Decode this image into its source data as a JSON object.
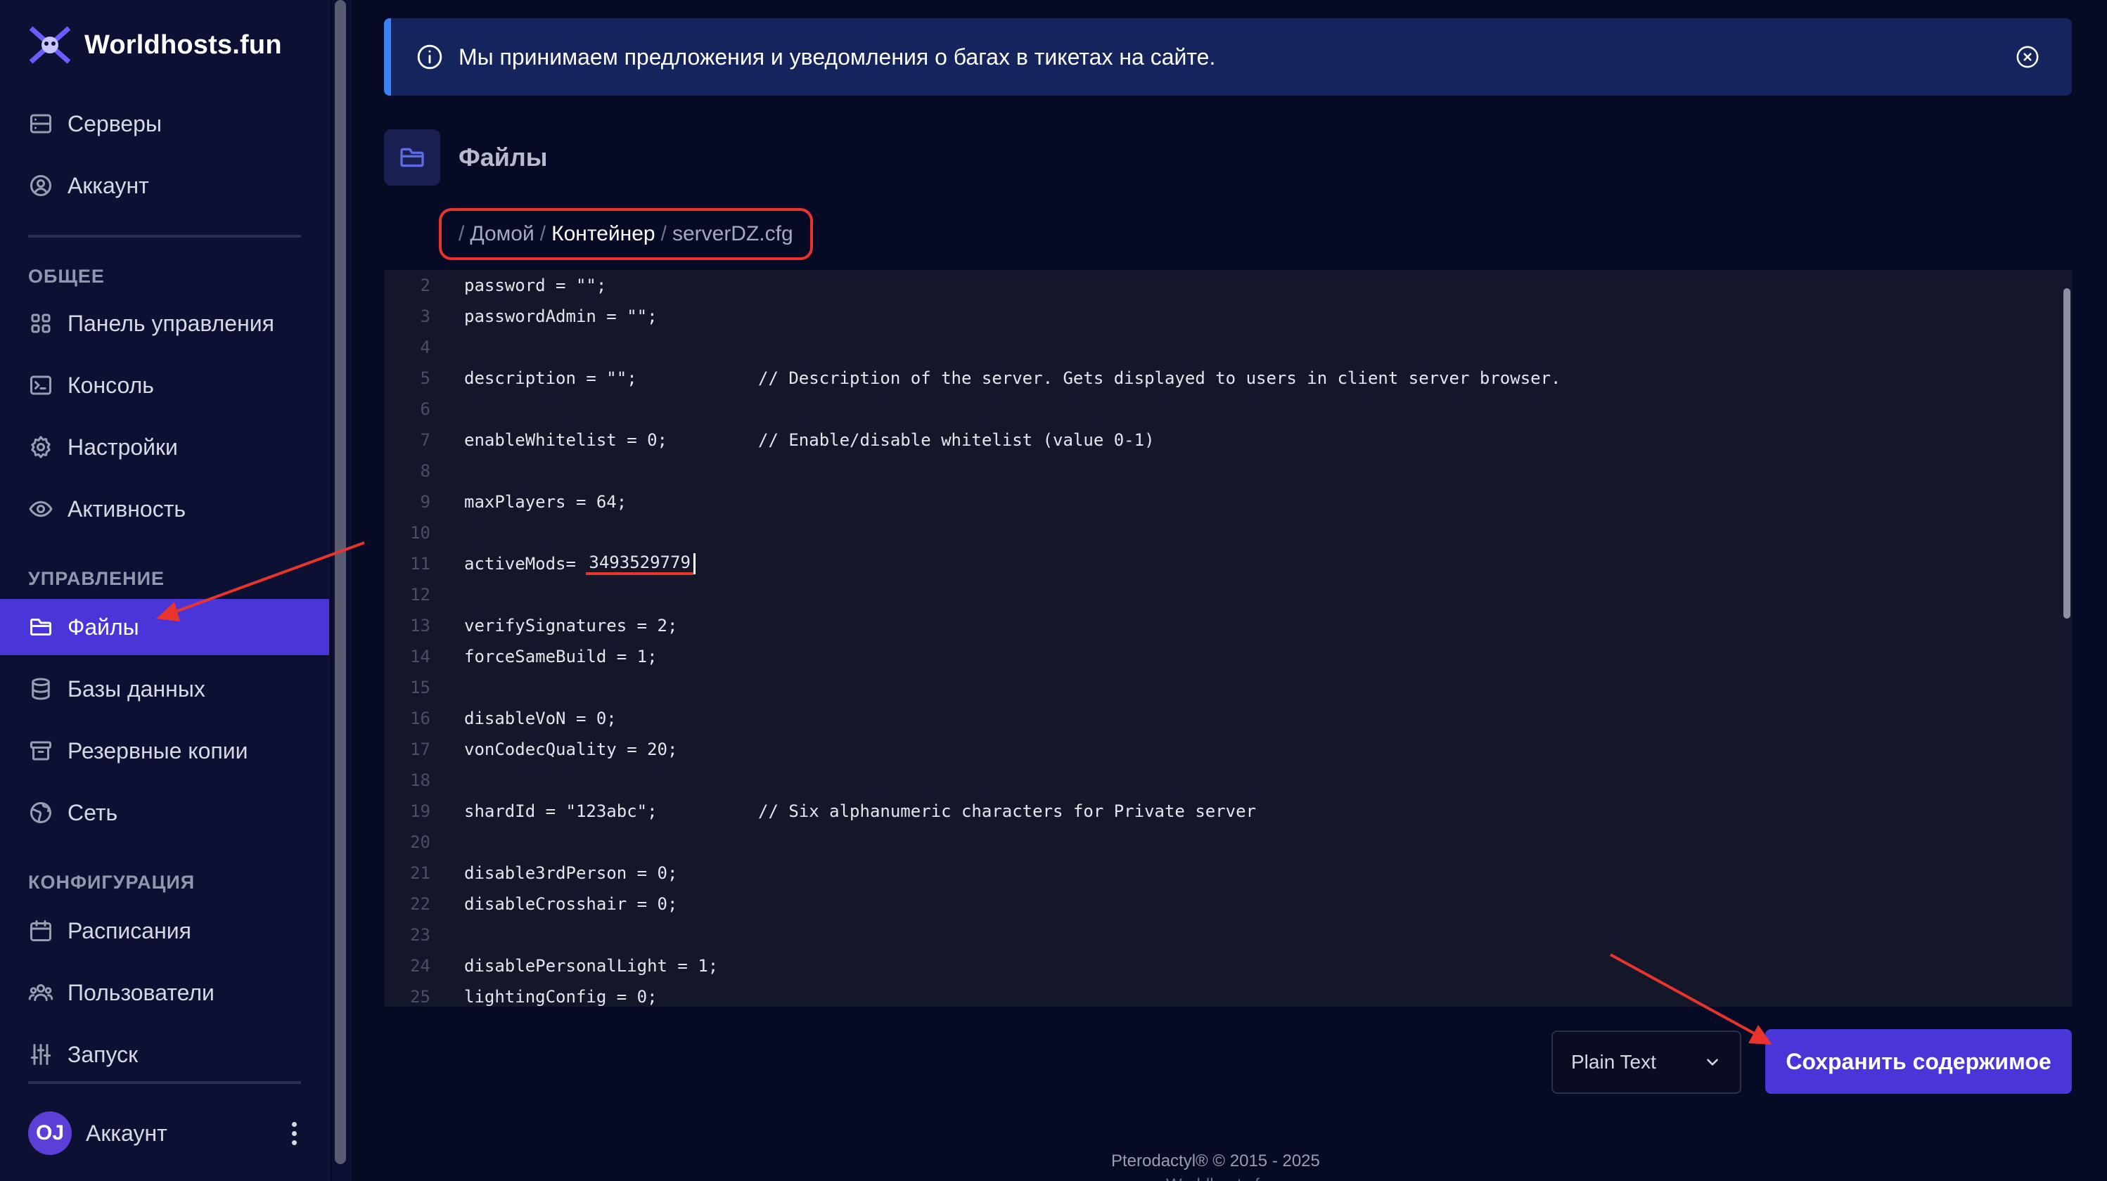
{
  "brand": {
    "name": "Worldhosts.fun"
  },
  "sidebar": {
    "top_items": [
      {
        "label": "Серверы",
        "icon": "server-icon"
      },
      {
        "label": "Аккаунт",
        "icon": "user-circle-icon"
      }
    ],
    "sections": {
      "general": "ОБЩЕЕ",
      "management": "УПРАВЛЕНИЕ",
      "configuration": "КОНФИГУРАЦИЯ"
    },
    "general_items": [
      {
        "label": "Панель управления",
        "icon": "grid-icon"
      },
      {
        "label": "Консоль",
        "icon": "terminal-icon"
      },
      {
        "label": "Настройки",
        "icon": "gear-icon"
      },
      {
        "label": "Активность",
        "icon": "eye-icon"
      }
    ],
    "management_items": [
      {
        "label": "Файлы",
        "icon": "folder-icon",
        "active": true
      },
      {
        "label": "Базы данных",
        "icon": "database-icon"
      },
      {
        "label": "Резервные копии",
        "icon": "archive-icon"
      },
      {
        "label": "Сеть",
        "icon": "globe-icon"
      }
    ],
    "configuration_items": [
      {
        "label": "Расписания",
        "icon": "calendar-icon"
      },
      {
        "label": "Пользователи",
        "icon": "users-icon"
      },
      {
        "label": "Запуск",
        "icon": "sliders-icon"
      }
    ],
    "account": {
      "initials": "OJ",
      "label": "Аккаунт"
    }
  },
  "alert": {
    "text": "Мы принимаем предложения и уведомления о багах в тикетах на сайте."
  },
  "page": {
    "title": "Файлы"
  },
  "breadcrumb": {
    "sep": "/",
    "home": "Домой",
    "folder": "Контейнер",
    "file": "serverDZ.cfg"
  },
  "editor": {
    "lines": [
      {
        "n": "2",
        "code": "password = \"\";"
      },
      {
        "n": "3",
        "code": "passwordAdmin = \"\";"
      },
      {
        "n": "4",
        "code": ""
      },
      {
        "n": "5",
        "code": "description = \"\";",
        "comment": "// Description of the server. Gets displayed to users in client server browser."
      },
      {
        "n": "6",
        "code": ""
      },
      {
        "n": "7",
        "code": "enableWhitelist = 0;",
        "comment": "// Enable/disable whitelist (value 0-1)"
      },
      {
        "n": "8",
        "code": ""
      },
      {
        "n": "9",
        "code": "maxPlayers = 64;"
      },
      {
        "n": "10",
        "code": ""
      },
      {
        "n": "11",
        "code": "activeMods=",
        "value": "3493529779"
      },
      {
        "n": "12",
        "code": ""
      },
      {
        "n": "13",
        "code": "verifySignatures = 2;"
      },
      {
        "n": "14",
        "code": "forceSameBuild = 1;"
      },
      {
        "n": "15",
        "code": ""
      },
      {
        "n": "16",
        "code": "disableVoN = 0;"
      },
      {
        "n": "17",
        "code": "vonCodecQuality = 20;"
      },
      {
        "n": "18",
        "code": ""
      },
      {
        "n": "19",
        "code": "shardId = \"123abc\";",
        "comment": "// Six alphanumeric characters for Private server"
      },
      {
        "n": "20",
        "code": ""
      },
      {
        "n": "21",
        "code": "disable3rdPerson = 0;"
      },
      {
        "n": "22",
        "code": "disableCrosshair = 0;"
      },
      {
        "n": "23",
        "code": ""
      },
      {
        "n": "24",
        "code": "disablePersonalLight = 1;"
      },
      {
        "n": "25",
        "code": "lightingConfig = 0;"
      }
    ]
  },
  "controls": {
    "syntax_mode": "Plain Text",
    "save_label": "Сохранить содержимое"
  },
  "footer": {
    "copyright": "Pterodactyl® © 2015 - 2025",
    "site": "Worldhosts.fun"
  },
  "colors": {
    "accent": "#4a36d8",
    "annotation": "#e8342c",
    "info": "#3b82f6"
  }
}
